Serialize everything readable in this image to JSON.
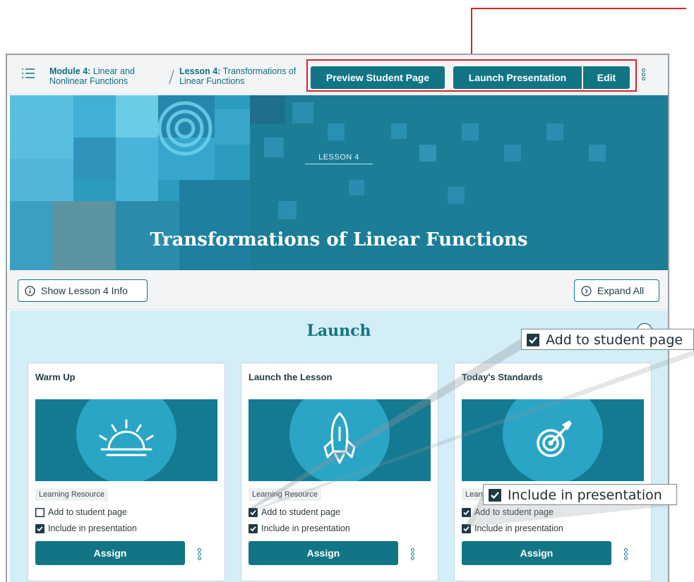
{
  "header": {
    "module_label_bold": "Module 4:",
    "module_label_rest": " Linear and Nonlinear Functions",
    "lesson_label_bold": "Lesson 4:",
    "lesson_label_rest": " Transformations of Linear Functions",
    "preview_button": "Preview Student Page",
    "launch_button": "Launch Presentation",
    "edit_button": "Edit"
  },
  "hero": {
    "eyebrow": "LESSON 4",
    "title": "Transformations of Linear Functions"
  },
  "infobar": {
    "show_info_button": "Show Lesson 4 Info",
    "expand_all_button": "Expand All"
  },
  "section": {
    "title": "Launch",
    "cards": [
      {
        "title": "Warm Up",
        "icon": "sunrise-icon",
        "tag": "Learning Resource",
        "add_label": "Add to student page",
        "add_checked": false,
        "include_label": "Include in presentation",
        "include_checked": true,
        "assign_label": "Assign"
      },
      {
        "title": "Launch the Lesson",
        "icon": "rocket-icon",
        "tag": "Learning Resource",
        "add_label": "Add to student page",
        "add_checked": true,
        "include_label": "Include in presentation",
        "include_checked": true,
        "assign_label": "Assign"
      },
      {
        "title": "Today's Standards",
        "icon": "target-icon",
        "tag": "Learning Resource",
        "add_label": "Add to student page",
        "add_checked": true,
        "include_label": "Include in presentation",
        "include_checked": true,
        "assign_label": "Assign"
      }
    ]
  },
  "callouts": {
    "add": "Add to student page",
    "include": "Include in presentation"
  },
  "colors": {
    "accent": "#117585",
    "hero": "#1b7d96",
    "section_bg": "#d4eef8",
    "highlight": "#d8232a"
  }
}
